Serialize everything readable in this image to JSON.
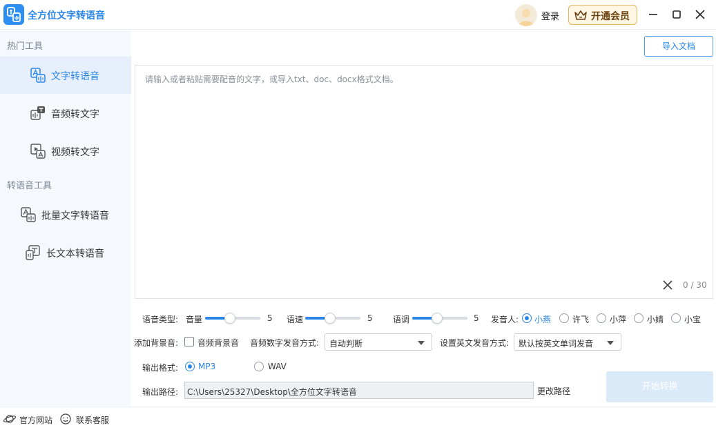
{
  "app": {
    "title": "全方位文字转语音"
  },
  "header": {
    "login": "登录",
    "vip": "开通会员"
  },
  "sidebar": {
    "section1": "热门工具",
    "items1": [
      {
        "label": "文字转语音",
        "icon": "text-to-speech-icon",
        "active": true
      },
      {
        "label": "音频转文字",
        "icon": "audio-to-text-icon"
      },
      {
        "label": "视频转文字",
        "icon": "video-to-text-icon"
      }
    ],
    "section2": "转语音工具",
    "items2": [
      {
        "label": "批量文字转语音",
        "icon": "batch-text-to-speech-icon"
      },
      {
        "label": "长文本转语音",
        "icon": "long-text-to-speech-icon"
      }
    ]
  },
  "footer": {
    "website": "官方网站",
    "support": "联系客服"
  },
  "main": {
    "import_label": "导入文档",
    "placeholder": "请输入或者粘贴需要配音的文字，或导入txt、doc、docx格式文档。",
    "counter": "0 / 30",
    "voice_type_label": "语音类型:",
    "volume": {
      "label": "音量",
      "value": "5",
      "level": 0.45
    },
    "speed": {
      "label": "语速",
      "value": "5",
      "level": 0.45
    },
    "pitch": {
      "label": "语调",
      "value": "5",
      "level": 0.45
    },
    "speaker_label": "发音人:",
    "speakers": [
      {
        "name": "小燕",
        "checked": true
      },
      {
        "name": "许飞"
      },
      {
        "name": "小萍"
      },
      {
        "name": "小婧"
      },
      {
        "name": "小宝"
      }
    ],
    "bg_label": "添加背景音:",
    "bg_checkbox": "音频背景音",
    "number_mode_label": "音频数字发音方式:",
    "number_mode_value": "自动判断",
    "english_mode_label": "设置英文发音方式:",
    "english_mode_value": "默认按英文单词发音",
    "format_label": "输出格式:",
    "formats": [
      {
        "name": "MP3",
        "checked": true
      },
      {
        "name": "WAV"
      }
    ],
    "path_label": "输出路径:",
    "path_value": "C:\\Users\\25327\\Desktop\\全方位文字转语音",
    "change_path": "更改路径",
    "start": "开始转换"
  },
  "colors": {
    "accent": "#2a86e8",
    "sidebar_bg": "#f5f8fc",
    "active_bg": "#e6effb",
    "vip_border": "#e6b460"
  }
}
